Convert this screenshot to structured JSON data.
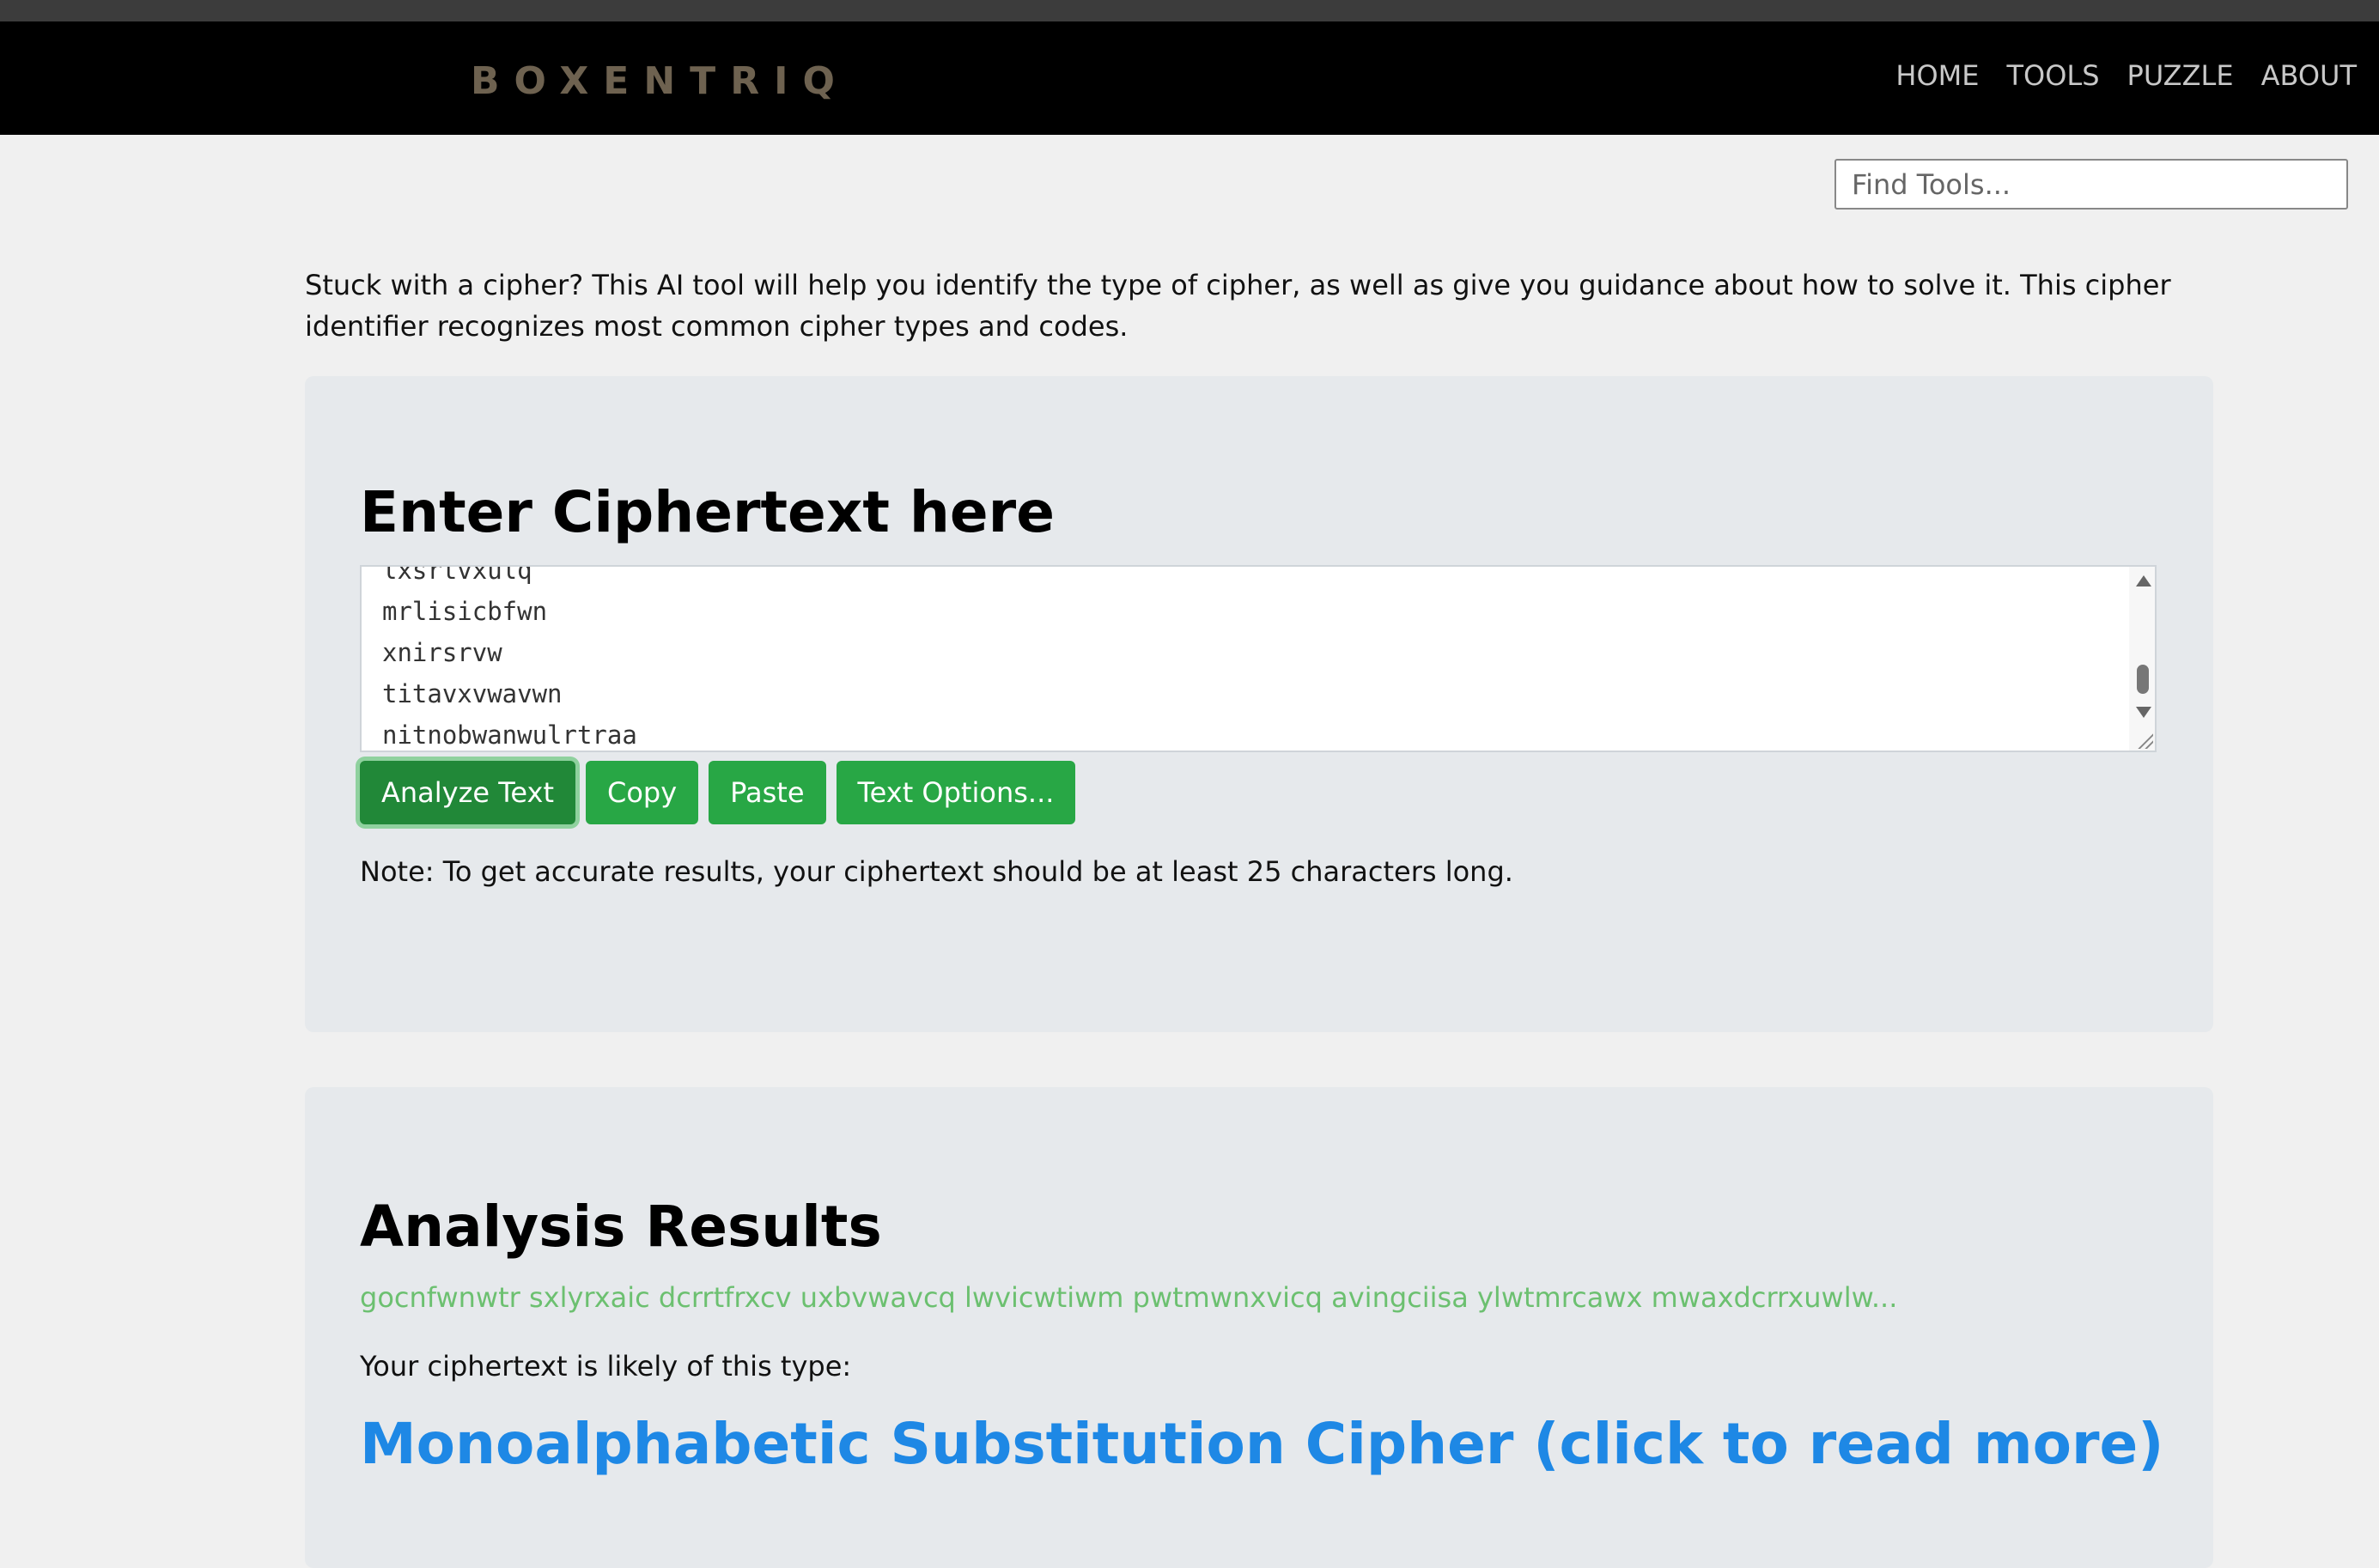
{
  "header": {
    "logo": "BOXENTRIQ",
    "nav": [
      "HOME",
      "TOOLS",
      "PUZZLE",
      "ABOUT"
    ]
  },
  "search": {
    "placeholder": "Find Tools..."
  },
  "intro": "Stuck with a cipher? This AI tool will help you identify the type of cipher, as well as give you guidance about how to solve it. This cipher identifier recognizes most common cipher types and codes.",
  "input_card": {
    "title": "Enter Ciphertext here",
    "textarea_lines": [
      "lxsrtvxulq",
      "mrlisicbfwn",
      "xnirsrvw",
      "titavxvwavwn",
      "nitnobwanwulrtraa"
    ],
    "buttons": {
      "analyze": "Analyze Text",
      "copy": "Copy",
      "paste": "Paste",
      "options": "Text Options..."
    },
    "note": "Note: To get accurate results, your ciphertext should be at least 25 characters long."
  },
  "results_card": {
    "title": "Analysis Results",
    "ciphertext_preview": "gocnfwnwtr sxlyrxaic dcrrtfrxcv uxbvwavcq lwvicwtiwm pwtmwnxvicq avingciisa ylwtmrcawx mwaxdcrrxuwlw...",
    "likely_label": "Your ciphertext is likely of this type:",
    "result_link": "Monoalphabetic Substitution Cipher (click to read more)"
  },
  "colors": {
    "button_green": "#28a745",
    "link_blue": "#1e88e5",
    "preview_green": "#6cc070"
  }
}
